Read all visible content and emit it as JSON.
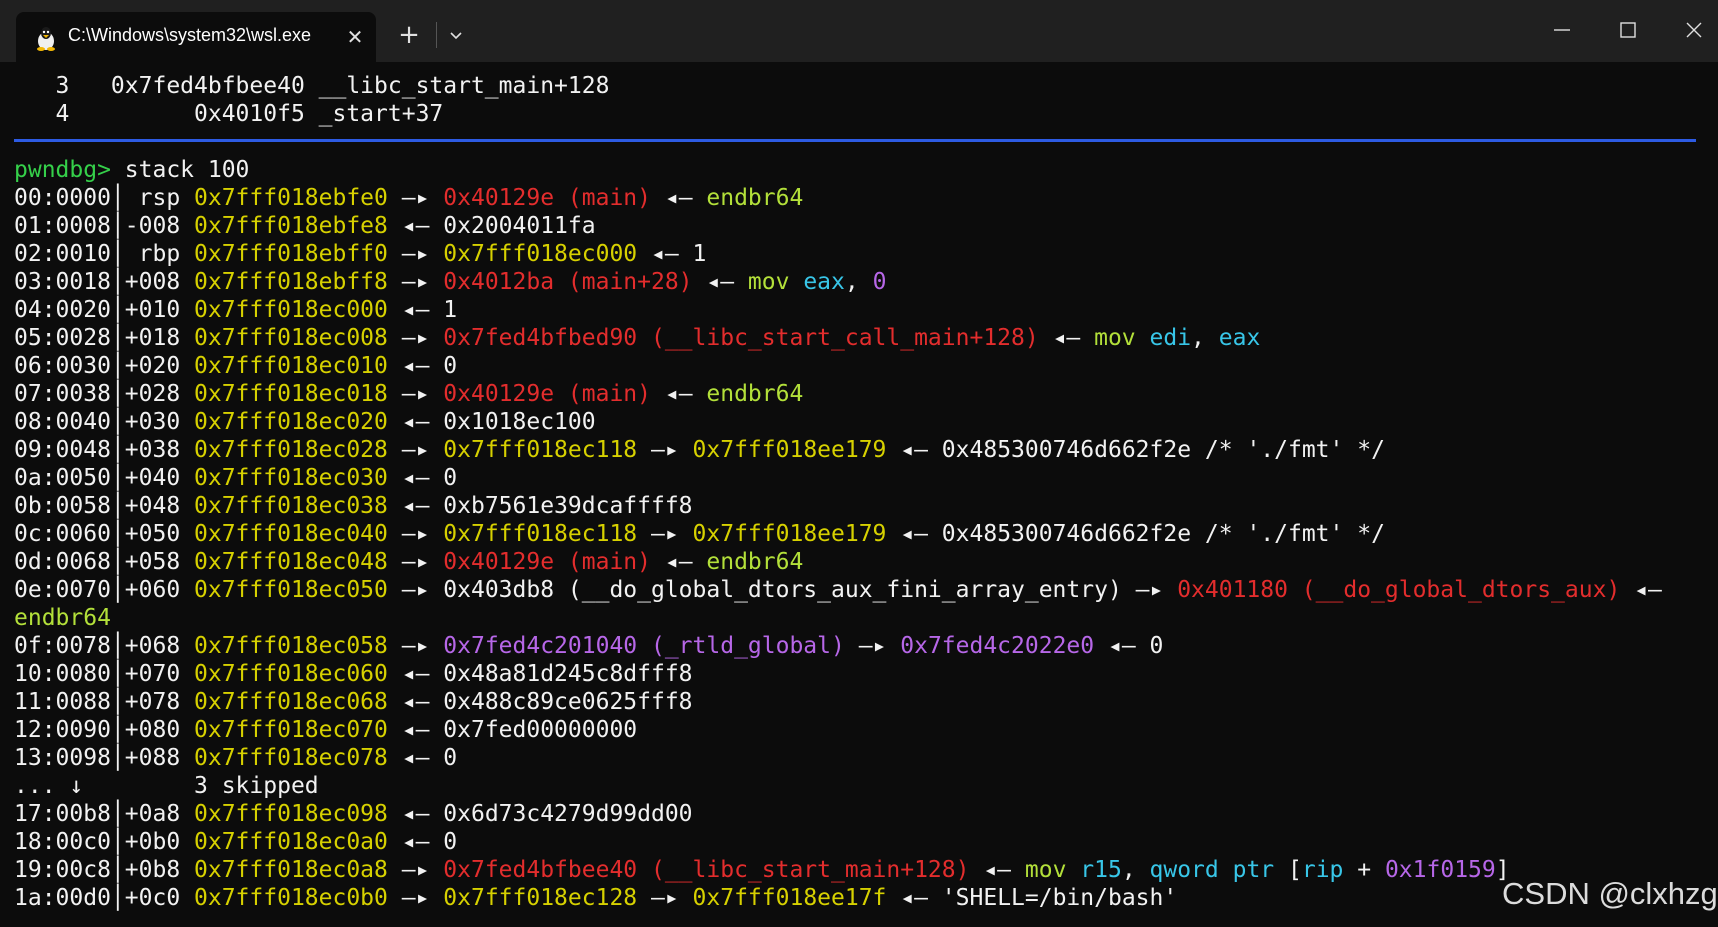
{
  "window": {
    "tab_title": "C:\\Windows\\system32\\wsl.exe",
    "tab_icon": "linux-penguin-icon",
    "close_tab_glyph": "✕",
    "new_tab_glyph": "+",
    "controls": [
      "minimize-icon",
      "maximize-icon",
      "close-icon"
    ]
  },
  "terminal": {
    "backtrace": [
      [
        {
          "t": "   3   0x7fed4bfbee40 __libc_start_main+128",
          "c": "w"
        }
      ],
      [
        {
          "t": "   4         0x4010f5 _start+37",
          "c": "w"
        }
      ]
    ],
    "prompt": "pwndbg>",
    "command": " stack 100",
    "lines": [
      [
        {
          "t": "00:0000│ rsp ",
          "c": "w"
        },
        {
          "t": "0x7fff018ebfe0",
          "c": "y"
        },
        {
          "t": " —▸ ",
          "c": "w"
        },
        {
          "t": "0x40129e (main)",
          "c": "r"
        },
        {
          "t": " ◂— ",
          "c": "w"
        },
        {
          "t": "endbr64",
          "c": "g"
        }
      ],
      [
        {
          "t": "01:0008│-008 ",
          "c": "w"
        },
        {
          "t": "0x7fff018ebfe8",
          "c": "y"
        },
        {
          "t": " ◂— 0x2004011fa",
          "c": "w"
        }
      ],
      [
        {
          "t": "02:0010│ rbp ",
          "c": "w"
        },
        {
          "t": "0x7fff018ebff0",
          "c": "y"
        },
        {
          "t": " —▸ ",
          "c": "w"
        },
        {
          "t": "0x7fff018ec000",
          "c": "y"
        },
        {
          "t": " ◂— 1",
          "c": "w"
        }
      ],
      [
        {
          "t": "03:0018│+008 ",
          "c": "w"
        },
        {
          "t": "0x7fff018ebff8",
          "c": "y"
        },
        {
          "t": " —▸ ",
          "c": "w"
        },
        {
          "t": "0x4012ba (main+28)",
          "c": "r"
        },
        {
          "t": " ◂— ",
          "c": "w"
        },
        {
          "t": "mov ",
          "c": "g"
        },
        {
          "t": "eax",
          "c": "c"
        },
        {
          "t": ", ",
          "c": "w"
        },
        {
          "t": "0",
          "c": "p"
        }
      ],
      [
        {
          "t": "04:0020│+010 ",
          "c": "w"
        },
        {
          "t": "0x7fff018ec000",
          "c": "y"
        },
        {
          "t": " ◂— 1",
          "c": "w"
        }
      ],
      [
        {
          "t": "05:0028│+018 ",
          "c": "w"
        },
        {
          "t": "0x7fff018ec008",
          "c": "y"
        },
        {
          "t": " —▸ ",
          "c": "w"
        },
        {
          "t": "0x7fed4bfbed90 (__libc_start_call_main+128)",
          "c": "r"
        },
        {
          "t": " ◂— ",
          "c": "w"
        },
        {
          "t": "mov ",
          "c": "g"
        },
        {
          "t": "edi",
          "c": "c"
        },
        {
          "t": ", ",
          "c": "w"
        },
        {
          "t": "eax",
          "c": "c"
        }
      ],
      [
        {
          "t": "06:0030│+020 ",
          "c": "w"
        },
        {
          "t": "0x7fff018ec010",
          "c": "y"
        },
        {
          "t": " ◂— 0",
          "c": "w"
        }
      ],
      [
        {
          "t": "07:0038│+028 ",
          "c": "w"
        },
        {
          "t": "0x7fff018ec018",
          "c": "y"
        },
        {
          "t": " —▸ ",
          "c": "w"
        },
        {
          "t": "0x40129e (main)",
          "c": "r"
        },
        {
          "t": " ◂— ",
          "c": "w"
        },
        {
          "t": "endbr64",
          "c": "g"
        }
      ],
      [
        {
          "t": "08:0040│+030 ",
          "c": "w"
        },
        {
          "t": "0x7fff018ec020",
          "c": "y"
        },
        {
          "t": " ◂— 0x1018ec100",
          "c": "w"
        }
      ],
      [
        {
          "t": "09:0048│+038 ",
          "c": "w"
        },
        {
          "t": "0x7fff018ec028",
          "c": "y"
        },
        {
          "t": " —▸ ",
          "c": "w"
        },
        {
          "t": "0x7fff018ec118",
          "c": "y"
        },
        {
          "t": " —▸ ",
          "c": "w"
        },
        {
          "t": "0x7fff018ee179",
          "c": "y"
        },
        {
          "t": " ◂— 0x485300746d662f2e /* './fmt' */",
          "c": "w"
        }
      ],
      [
        {
          "t": "0a:0050│+040 ",
          "c": "w"
        },
        {
          "t": "0x7fff018ec030",
          "c": "y"
        },
        {
          "t": " ◂— 0",
          "c": "w"
        }
      ],
      [
        {
          "t": "0b:0058│+048 ",
          "c": "w"
        },
        {
          "t": "0x7fff018ec038",
          "c": "y"
        },
        {
          "t": " ◂— 0xb7561e39dcaffff8",
          "c": "w"
        }
      ],
      [
        {
          "t": "0c:0060│+050 ",
          "c": "w"
        },
        {
          "t": "0x7fff018ec040",
          "c": "y"
        },
        {
          "t": " —▸ ",
          "c": "w"
        },
        {
          "t": "0x7fff018ec118",
          "c": "y"
        },
        {
          "t": " —▸ ",
          "c": "w"
        },
        {
          "t": "0x7fff018ee179",
          "c": "y"
        },
        {
          "t": " ◂— 0x485300746d662f2e /* './fmt' */",
          "c": "w"
        }
      ],
      [
        {
          "t": "0d:0068│+058 ",
          "c": "w"
        },
        {
          "t": "0x7fff018ec048",
          "c": "y"
        },
        {
          "t": " —▸ ",
          "c": "w"
        },
        {
          "t": "0x40129e (main)",
          "c": "r"
        },
        {
          "t": " ◂— ",
          "c": "w"
        },
        {
          "t": "endbr64",
          "c": "g"
        }
      ],
      [
        {
          "t": "0e:0070│+060 ",
          "c": "w"
        },
        {
          "t": "0x7fff018ec050",
          "c": "y"
        },
        {
          "t": " —▸ 0x403db8 (__do_global_dtors_aux_fini_array_entry) —▸ ",
          "c": "w"
        },
        {
          "t": "0x401180 (__do_global_dtors_aux)",
          "c": "r"
        },
        {
          "t": " ◂—",
          "c": "w"
        }
      ],
      [
        {
          "t": "endbr64",
          "c": "g"
        }
      ],
      [
        {
          "t": "0f:0078│+068 ",
          "c": "w"
        },
        {
          "t": "0x7fff018ec058",
          "c": "y"
        },
        {
          "t": " —▸ ",
          "c": "w"
        },
        {
          "t": "0x7fed4c201040 (_rtld_global)",
          "c": "p"
        },
        {
          "t": " —▸ ",
          "c": "w"
        },
        {
          "t": "0x7fed4c2022e0",
          "c": "p"
        },
        {
          "t": " ◂— 0",
          "c": "w"
        }
      ],
      [
        {
          "t": "10:0080│+070 ",
          "c": "w"
        },
        {
          "t": "0x7fff018ec060",
          "c": "y"
        },
        {
          "t": " ◂— 0x48a81d245c8dfff8",
          "c": "w"
        }
      ],
      [
        {
          "t": "11:0088│+078 ",
          "c": "w"
        },
        {
          "t": "0x7fff018ec068",
          "c": "y"
        },
        {
          "t": " ◂— 0x488c89ce0625fff8",
          "c": "w"
        }
      ],
      [
        {
          "t": "12:0090│+080 ",
          "c": "w"
        },
        {
          "t": "0x7fff018ec070",
          "c": "y"
        },
        {
          "t": " ◂— 0x7fed00000000",
          "c": "w"
        }
      ],
      [
        {
          "t": "13:0098│+088 ",
          "c": "w"
        },
        {
          "t": "0x7fff018ec078",
          "c": "y"
        },
        {
          "t": " ◂— 0",
          "c": "w"
        }
      ],
      [
        {
          "t": "... ↓        3 skipped",
          "c": "w"
        }
      ],
      [
        {
          "t": "17:00b8│+0a8 ",
          "c": "w"
        },
        {
          "t": "0x7fff018ec098",
          "c": "y"
        },
        {
          "t": " ◂— 0x6d73c4279d99dd00",
          "c": "w"
        }
      ],
      [
        {
          "t": "18:00c0│+0b0 ",
          "c": "w"
        },
        {
          "t": "0x7fff018ec0a0",
          "c": "y"
        },
        {
          "t": " ◂— 0",
          "c": "w"
        }
      ],
      [
        {
          "t": "19:00c8│+0b8 ",
          "c": "w"
        },
        {
          "t": "0x7fff018ec0a8",
          "c": "y"
        },
        {
          "t": " —▸ ",
          "c": "w"
        },
        {
          "t": "0x7fed4bfbee40 (__libc_start_main+128)",
          "c": "r"
        },
        {
          "t": " ◂— ",
          "c": "w"
        },
        {
          "t": "mov ",
          "c": "g"
        },
        {
          "t": "r15",
          "c": "c"
        },
        {
          "t": ", ",
          "c": "w"
        },
        {
          "t": "qword ptr ",
          "c": "c"
        },
        {
          "t": "[",
          "c": "w"
        },
        {
          "t": "rip",
          "c": "c"
        },
        {
          "t": " + ",
          "c": "w"
        },
        {
          "t": "0x1f0159",
          "c": "p"
        },
        {
          "t": "]",
          "c": "w"
        }
      ],
      [
        {
          "t": "1a:00d0│+0c0 ",
          "c": "w"
        },
        {
          "t": "0x7fff018ec0b0",
          "c": "y"
        },
        {
          "t": " —▸ ",
          "c": "w"
        },
        {
          "t": "0x7fff018ec128",
          "c": "y"
        },
        {
          "t": " —▸ ",
          "c": "w"
        },
        {
          "t": "0x7fff018ee17f",
          "c": "y"
        },
        {
          "t": " ◂— 'SHELL=/bin/bash'",
          "c": "w"
        }
      ]
    ]
  },
  "watermark": "CSDN @clxhzg",
  "colors": {
    "white": "#f2f2f2",
    "yellow": "#d7d100",
    "red": "#e32d2d",
    "lime": "#b3e03a",
    "prompt_green": "#35d04a",
    "cyan": "#38c6e8",
    "purple": "#b767e8",
    "divider_blue": "#2d5be3"
  }
}
